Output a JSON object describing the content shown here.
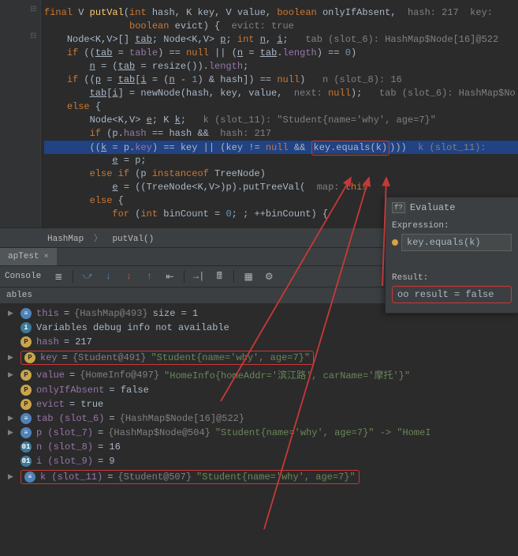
{
  "code": {
    "l1_a": "final ",
    "l1_b": "V ",
    "l1_c": "putVal",
    "l1_d": "(",
    "l1_e": "int ",
    "l1_f": "hash, ",
    "l1_g": "K ",
    "l1_h": "key, ",
    "l1_i": "V ",
    "l1_j": "value, ",
    "l1_k": "boolean ",
    "l1_l": "onlyIfAbsent,  ",
    "l1_m": "hash: 217  key:",
    "l2_a": "boolean ",
    "l2_b": "evict) {  ",
    "l2_c": "evict: true",
    "l3_a": "Node<",
    "l3_b": "K",
    "l3_c": ",",
    "l3_d": "V",
    "l3_e": ">[] ",
    "l3_f": "tab",
    "l3_g": "; Node<",
    "l3_h": "K",
    "l3_i": ",",
    "l3_j": "V",
    "l3_k": "> ",
    "l3_l": "p",
    "l3_m": "; ",
    "l3_n": "int ",
    "l3_o": "n",
    "l3_p": ", ",
    "l3_q": "i",
    "l3_r": ";   ",
    "l3_s": "tab (slot_6): HashMap$Node[16]@522",
    "l4_a": "if ",
    "l4_b": "((",
    "l4_c": "tab",
    "l4_d": " = ",
    "l4_e": "table",
    "l4_f": ") == ",
    "l4_g": "null ",
    "l4_h": "|| (",
    "l4_i": "n",
    "l4_j": " = ",
    "l4_k": "tab",
    "l4_l": ".",
    "l4_m": "length",
    "l4_n": ") == ",
    "l4_o": "0",
    "l4_p": ")",
    "l5_a": "n",
    "l5_b": " = (",
    "l5_c": "tab",
    "l5_d": " = resize()).",
    "l5_e": "length",
    "l5_f": ";",
    "l6_a": "if ",
    "l6_b": "((",
    "l6_c": "p",
    "l6_d": " = ",
    "l6_e": "tab",
    "l6_f": "[",
    "l6_g": "i",
    "l6_h": " = (",
    "l6_i": "n",
    "l6_j": " - ",
    "l6_k": "1",
    "l6_l": ") & hash]) == ",
    "l6_m": "null",
    "l6_n": ")   ",
    "l6_o": "n (slot_8): 16",
    "l7_a": "tab",
    "l7_b": "[",
    "l7_c": "i",
    "l7_d": "] = newNode(hash, key, value,  ",
    "l7_e": "next: ",
    "l7_f": "null",
    "l7_g": ");   ",
    "l7_h": "tab (slot_6): HashMap$No",
    "l8_a": "else ",
    "l8_b": "{",
    "l9_a": "Node<",
    "l9_b": "K",
    "l9_c": ",",
    "l9_d": "V",
    "l9_e": "> ",
    "l9_f": "e",
    "l9_g": "; ",
    "l9_h": "K ",
    "l9_i": "k",
    "l9_j": ";   ",
    "l9_k": "k (slot_11): \"Student{name='why', age=7}\"",
    "l10_a": "if ",
    "l10_b": "(p.",
    "l10_c": "hash ",
    "l10_d": "== hash &&  ",
    "l10_e": "hash: 217",
    "l11_a": "        ((",
    "l11_b": "k",
    "l11_c": " = p.",
    "l11_d": "key",
    "l11_e": ") == key || (key != ",
    "l11_f": "null ",
    "l11_g": "&& ",
    "l11_h": "key.equals(k)",
    "l11_i": ")))  ",
    "l11_j": "k (slot_11):",
    "l12_a": "e",
    "l12_b": " = p;",
    "l13_a": "else if ",
    "l13_b": "(p ",
    "l13_c": "instanceof ",
    "l13_d": "TreeNode)",
    "l14_a": "e",
    "l14_b": " = ((TreeNode<",
    "l14_c": "K",
    "l14_d": ",",
    "l14_e": "V",
    "l14_f": ">)p).putTreeVal(  ",
    "l14_g": "map: ",
    "l14_h": "this",
    "l15_a": "else ",
    "l15_b": "{",
    "l16_a": "for ",
    "l16_b": "(",
    "l16_c": "int ",
    "l16_d": "binCount = ",
    "l16_e": "0",
    "l16_f": "; ; ++binCount) {"
  },
  "breadcrumb": {
    "class": "HashMap",
    "method": "putVal()"
  },
  "tab": {
    "name": "apTest",
    "close": "×"
  },
  "toolbar": {
    "label": "Console"
  },
  "vars": {
    "header": "ables",
    "this_name": "this",
    "this_eq": " = ",
    "this_type": "{HashMap@493}",
    "this_size": "  size = 1",
    "info": "Variables debug info not available",
    "hash_name": "hash",
    "hash_val": " = 217",
    "key_name": "key",
    "key_eq": " = ",
    "key_type": "{Student@491}",
    "key_val": " \"Student{name='why', age=7}\"",
    "value_name": "value",
    "value_eq": " = ",
    "value_type": "{HomeInfo@497}",
    "value_val": " \"HomeInfo{homeAddr='滨江路', carName='摩托'}\"",
    "onlyIf_name": "onlyIfAbsent",
    "onlyIf_val": " = false",
    "evict_name": "evict",
    "evict_val": " = true",
    "tab_name": "tab (slot_6)",
    "tab_eq": " = ",
    "tab_type": "{HashMap$Node[16]@522}",
    "p_name": "p (slot_7)",
    "p_eq": " = ",
    "p_type": "{HashMap$Node@504}",
    "p_val": " \"Student{name='why', age=7}\" -> \"HomeI",
    "n_name": "n (slot_8)",
    "n_val": " = 16",
    "i_name": "i (slot_9)",
    "i_val": " = 9",
    "k_name": "k (slot_11)",
    "k_eq": " = ",
    "k_type": "{Student@507}",
    "k_val": " \"Student{name='why', age=7}\""
  },
  "eval": {
    "title": "Evaluate",
    "expr_label": "Expression:",
    "expr_value": "key.equals(k)",
    "result_label": "Result:",
    "result_text": "oo result = false"
  }
}
